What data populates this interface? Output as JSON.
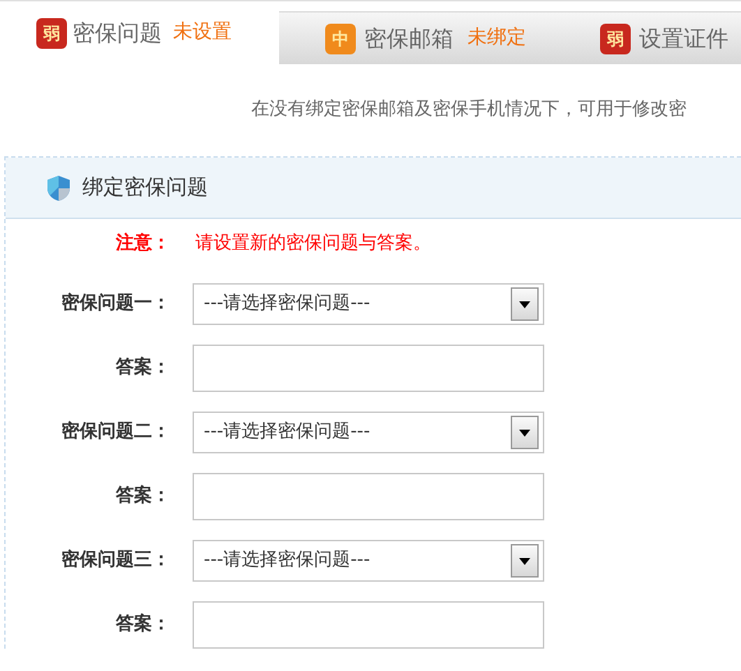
{
  "tabs": [
    {
      "badge": "弱",
      "color": "#c8281e",
      "label": "密保问题",
      "status": "未设置",
      "selected": true
    },
    {
      "badge": "中",
      "color": "#f08a1c",
      "label": "密保邮箱",
      "status": "未绑定",
      "selected": false
    },
    {
      "badge": "弱",
      "color": "#c8281e",
      "label": "设置证件",
      "selected": false
    }
  ],
  "description": "在没有绑定密保邮箱及密保手机情况下，可用于修改密",
  "panel": {
    "title": "绑定密保问题",
    "notice": {
      "label": "注意：",
      "text": "请设置新的密保问题与答案。"
    },
    "fields": [
      {
        "kind": "select",
        "label": "密保问题一：",
        "value": "---请选择密保问题---"
      },
      {
        "kind": "text",
        "label": "答案："
      },
      {
        "kind": "select",
        "label": "密保问题二：",
        "value": "---请选择密保问题---"
      },
      {
        "kind": "text",
        "label": "答案："
      },
      {
        "kind": "select",
        "label": "密保问题三：",
        "value": "---请选择密保问题---"
      },
      {
        "kind": "text",
        "label": "答案："
      }
    ]
  }
}
